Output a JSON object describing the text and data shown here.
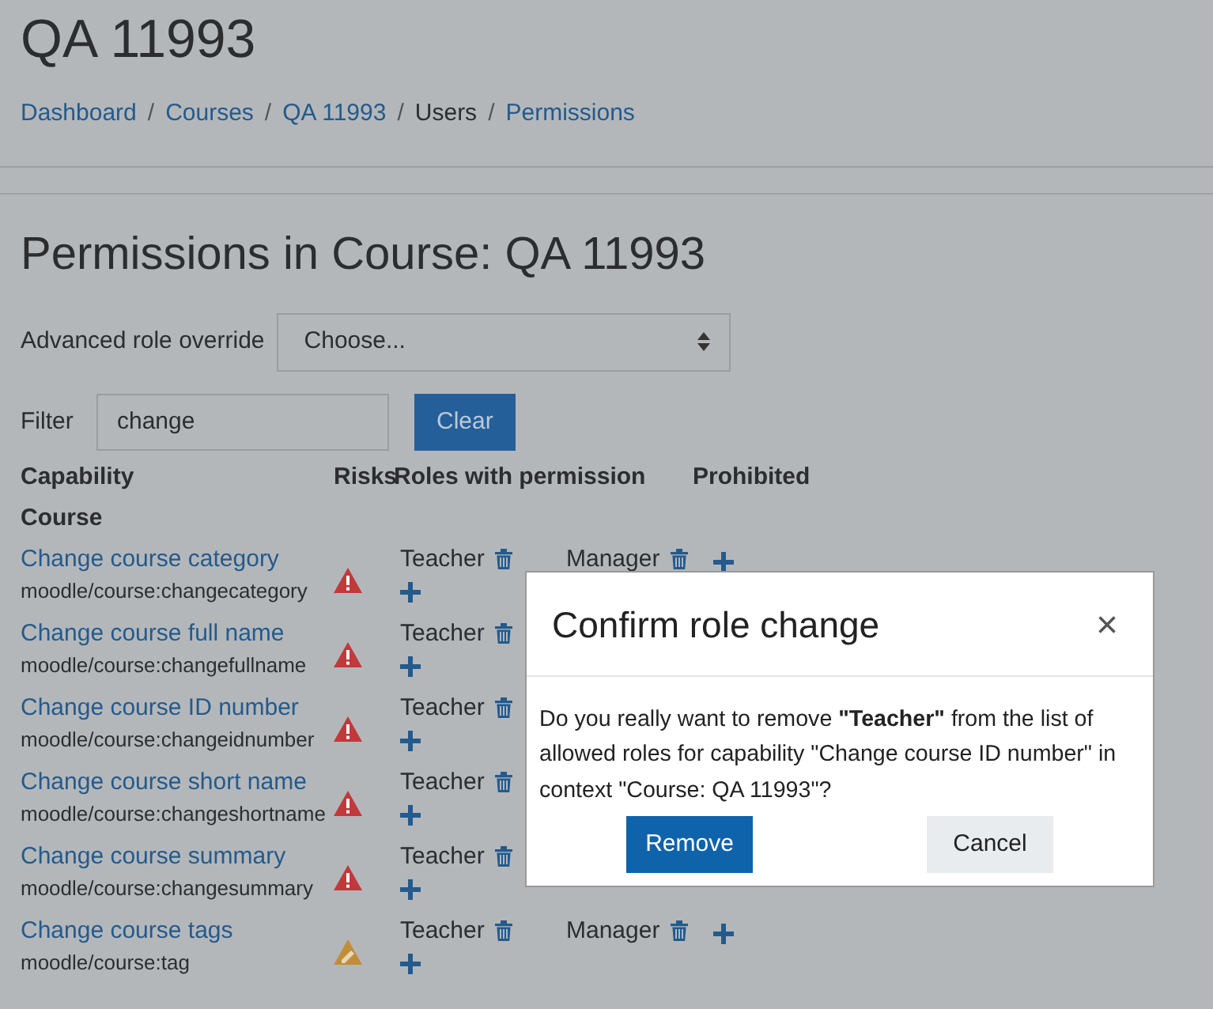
{
  "page_title": "QA 11993",
  "breadcrumb_separator": "/",
  "breadcrumbs": [
    {
      "label": "Dashboard",
      "link": true
    },
    {
      "label": "Courses",
      "link": true
    },
    {
      "label": "QA 11993",
      "link": true
    },
    {
      "label": "Users",
      "link": false
    },
    {
      "label": "Permissions",
      "link": true
    }
  ],
  "heading": "Permissions in Course: QA 11993",
  "override": {
    "label": "Advanced role override",
    "value": "Choose..."
  },
  "filter": {
    "label": "Filter",
    "value": "change",
    "button": "Clear"
  },
  "table": {
    "columns": [
      "Capability",
      "Risks",
      "Roles with permission",
      "Prohibited"
    ],
    "section": "Course",
    "rows": [
      {
        "name": "Change course category",
        "capability": "moodle/course:changecategory",
        "kind": "danger",
        "roles": [
          "Teacher"
        ],
        "prohibited": [
          "Manager"
        ]
      },
      {
        "name": "Change course full name",
        "capability": "moodle/course:changefullname",
        "kind": "danger",
        "roles": [
          "Teacher"
        ],
        "prohibited": []
      },
      {
        "name": "Change course ID number",
        "capability": "moodle/course:changeidnumber",
        "kind": "danger",
        "roles": [
          "Teacher"
        ],
        "prohibited": []
      },
      {
        "name": "Change course short name",
        "capability": "moodle/course:changeshortname",
        "kind": "danger",
        "roles": [
          "Teacher"
        ],
        "prohibited": []
      },
      {
        "name": "Change course summary",
        "capability": "moodle/course:changesummary",
        "kind": "danger",
        "roles": [
          "Teacher"
        ],
        "prohibited": []
      },
      {
        "name": "Change course tags",
        "capability": "moodle/course:tag",
        "kind": "caution",
        "roles": [
          "Teacher"
        ],
        "prohibited": [
          "Manager"
        ]
      }
    ]
  },
  "dialog": {
    "title": "Confirm role change",
    "close": "×",
    "message": "Do you really want to remove **\"Teacher\"** from the list of allowed roles for capability \"Change course ID number\" in context \"Course: QA 11993\"?",
    "buttons": [
      {
        "label": "Remove",
        "kind": "primary"
      },
      {
        "label": "Cancel",
        "kind": "secondary"
      }
    ]
  }
}
